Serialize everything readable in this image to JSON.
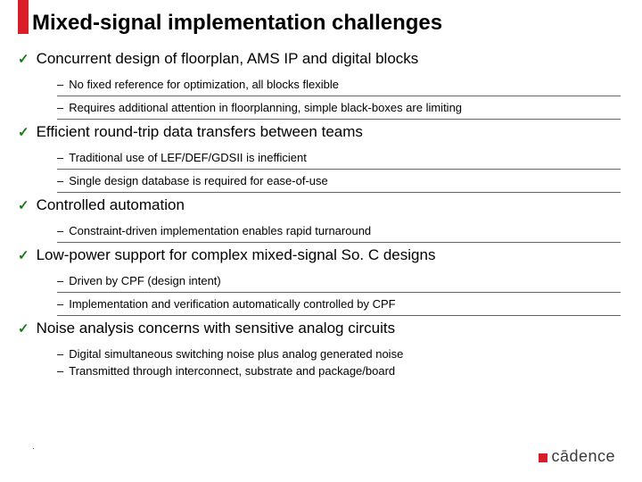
{
  "title": "Mixed-signal implementation challenges",
  "items": [
    {
      "text": "Concurrent design of floorplan, AMS IP and digital blocks",
      "subs": [
        "No fixed reference for optimization, all blocks flexible",
        "Requires additional attention in floorplanning, simple black-boxes are limiting"
      ]
    },
    {
      "text": "Efficient round-trip data transfers between teams",
      "subs": [
        "Traditional use of LEF/DEF/GDSII is inefficient",
        "Single design database is required for ease-of-use"
      ]
    },
    {
      "text": "Controlled automation",
      "subs": [
        "Constraint-driven implementation enables rapid turnaround"
      ]
    },
    {
      "text": "Low-power support for complex mixed-signal So. C designs",
      "subs": [
        "Driven by CPF (design intent)",
        "Implementation and verification automatically controlled by CPF"
      ]
    },
    {
      "text": "Noise analysis concerns with sensitive analog circuits",
      "subs": [
        "Digital simultaneous switching noise plus analog generated noise",
        "Transmitted through interconnect, substrate and package/board"
      ]
    }
  ],
  "logo_text": "cādence",
  "footer": "."
}
